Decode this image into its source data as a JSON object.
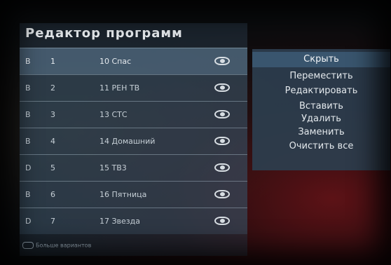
{
  "title": "Редактор программ",
  "channels": [
    {
      "fav": "B",
      "num": "1",
      "name": "10 Спас",
      "selected": true
    },
    {
      "fav": "B",
      "num": "2",
      "name": "11 РЕН ТВ",
      "selected": false
    },
    {
      "fav": "B",
      "num": "3",
      "name": "13 СТС",
      "selected": false
    },
    {
      "fav": "B",
      "num": "4",
      "name": "14 Домашний",
      "selected": false
    },
    {
      "fav": "D",
      "num": "5",
      "name": "15 ТВ3",
      "selected": false
    },
    {
      "fav": "B",
      "num": "6",
      "name": "16 Пятница",
      "selected": false
    },
    {
      "fav": "D",
      "num": "7",
      "name": "17 Звезда",
      "selected": false
    }
  ],
  "footer": {
    "label": "Больше вариантов"
  },
  "menu": {
    "items": [
      {
        "label": "Скрыть"
      },
      {
        "label": "Переместить"
      },
      {
        "label": "Редактировать"
      },
      {
        "label": "Вставить"
      },
      {
        "label": "Удалить"
      },
      {
        "label": "Заменить"
      },
      {
        "label": "Очистить все"
      }
    ]
  }
}
